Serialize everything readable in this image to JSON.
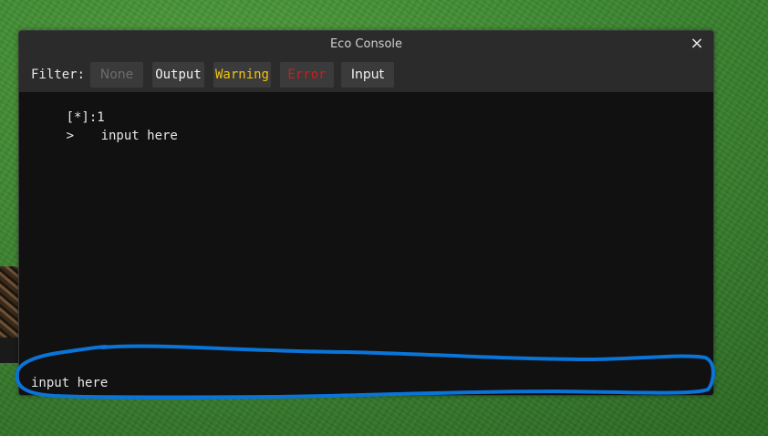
{
  "window": {
    "title": "Eco Console",
    "close_glyph": "×"
  },
  "filter": {
    "label": "Filter:",
    "buttons": [
      {
        "label": "None",
        "color": "#6d6d6d"
      },
      {
        "label": "Output",
        "color": "#f2f2f2"
      },
      {
        "label": "Warning",
        "color": "#f4c20d"
      },
      {
        "label": "Error",
        "color": "#d11c1c"
      },
      {
        "label": "Input",
        "color": "#f2f2f2"
      }
    ]
  },
  "output": {
    "lines": [
      {
        "text": "[*]:1"
      },
      {
        "prompt": ">",
        "text": "input here"
      }
    ]
  },
  "input": {
    "value": "input here"
  },
  "annotation": {
    "shape": "hand-drawn-ellipse",
    "color": "#0a74d8"
  }
}
